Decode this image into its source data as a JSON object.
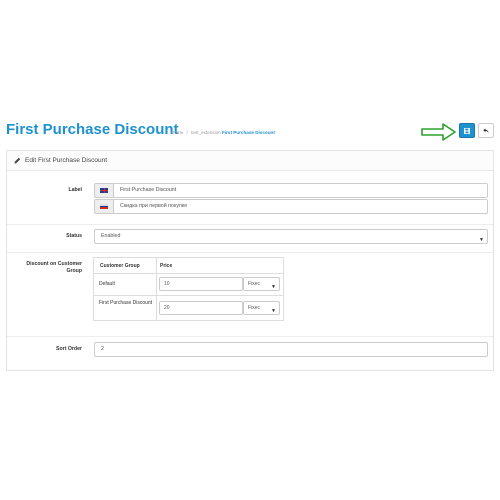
{
  "header": {
    "title": "First Purchase Discount",
    "breadcrumb": [
      "Home",
      "/",
      "test_extension",
      "First Purchase Discount"
    ]
  },
  "toolbar": {
    "save_icon": "save-icon",
    "back_icon": "reply-icon",
    "arrow_color": "#2ea02e"
  },
  "panel": {
    "heading": "Edit First Purchase Discount",
    "heading_icon": "pencil-icon",
    "label_field": {
      "label": "Label",
      "values": [
        {
          "lang": "en",
          "flag": "uk-flag-icon",
          "value": "First Purchase Discount"
        },
        {
          "lang": "ru",
          "flag": "ru-flag-icon",
          "value": "Скидка при первой покупке"
        }
      ]
    },
    "status_field": {
      "label": "Status",
      "value": "Enabled"
    },
    "discount_field": {
      "label": "Discount on Customer Group",
      "columns": [
        "Customer Group",
        "Price"
      ],
      "rows": [
        {
          "group": "Default",
          "price": "10",
          "type": "Fixec"
        },
        {
          "group": "First Purchase Discount",
          "price": "20",
          "type": "Fixec"
        }
      ]
    },
    "sort_order_field": {
      "label": "Sort Order",
      "value": "2"
    }
  },
  "colors": {
    "accent": "#1e91cf",
    "border": "#cccccc"
  }
}
